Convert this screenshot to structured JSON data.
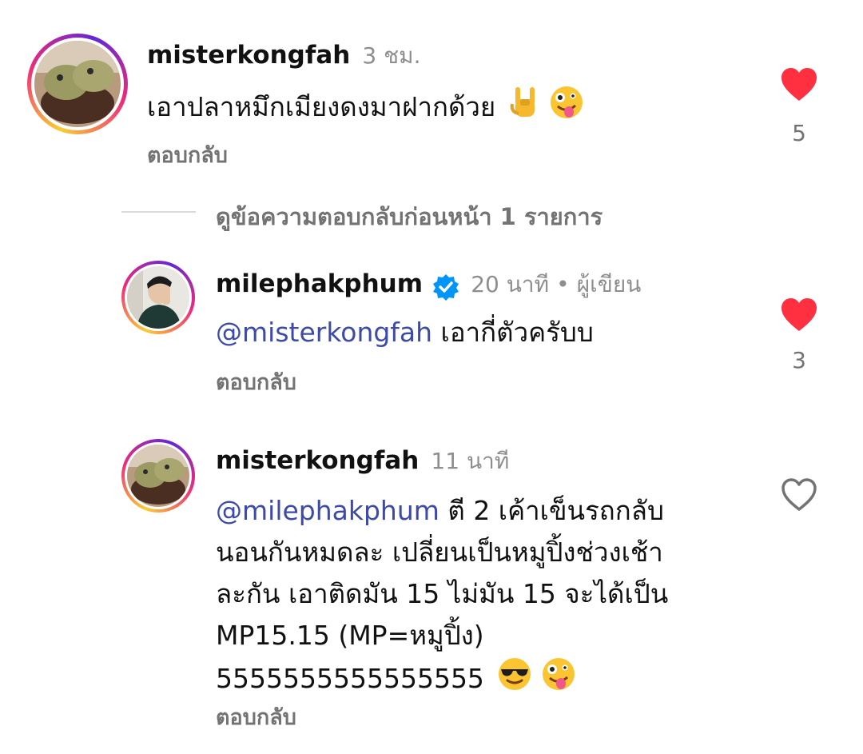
{
  "comment1": {
    "username": "misterkongfah",
    "time": "3 ชม.",
    "text": "เอาปลาหมึกเมียงดงมาฝากด้วย",
    "emoji_icons": [
      "rock-hand-emoji-icon",
      "zany-face-emoji-icon"
    ],
    "reply_label": "ตอบกลับ",
    "like_count": "5",
    "liked": true
  },
  "view_replies": {
    "label": "ดูข้อความตอบกลับก่อนหน้า 1 รายการ"
  },
  "reply1": {
    "username": "milephakphum",
    "verified": true,
    "time": "20 นาที",
    "separator": "•",
    "author_tag": "ผู้เขียน",
    "mention": "@misterkongfah",
    "text": " เอากี่ตัวครับบ",
    "reply_label": "ตอบกลับ",
    "like_count": "3",
    "liked": true
  },
  "reply2": {
    "username": "misterkongfah",
    "time": "11 นาที",
    "mention": "@milephakphum",
    "line1": " ตี 2 เค้าเข็นรถกลับ",
    "line2": "นอนกันหมดละ  เปลี่ยนเป็นหมูปิ้งช่วงเช้า",
    "line3": "ละกัน เอาติดมัน 15 ไม่มัน 15  จะได้เป็น",
    "line4": "MP15.15 (MP=หมูปิ้ง)",
    "line5": "5555555555555555",
    "emoji_icons": [
      "sunglasses-face-emoji-icon",
      "zany-face-emoji-icon"
    ],
    "reply_label": "ตอบกลับ",
    "liked": false
  },
  "colors": {
    "like_red": "#ff3040",
    "mention_blue": "#3d4aa8",
    "verified_blue": "#0095f6",
    "muted_gray": "#737373"
  }
}
